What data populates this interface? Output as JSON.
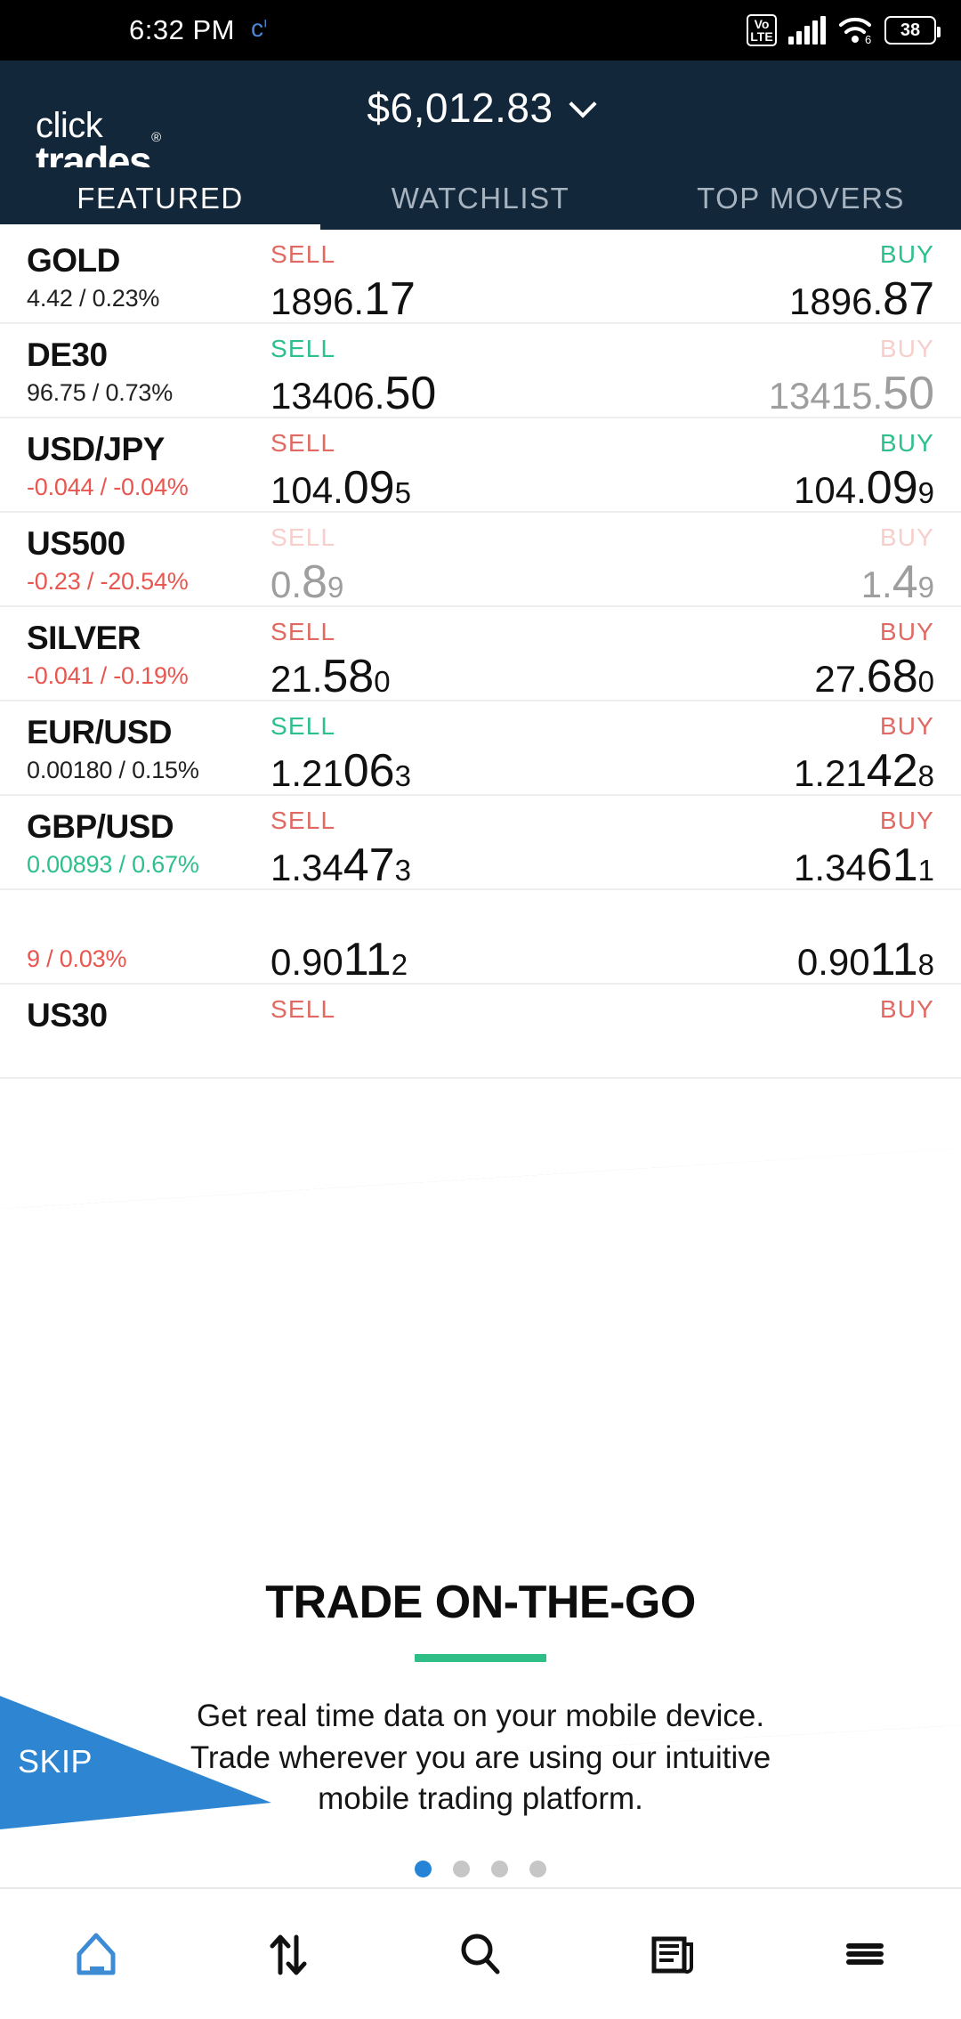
{
  "status_bar": {
    "time": "6:32 PM",
    "network_icon": "c-network-icon",
    "volte_top": "Vo",
    "volte_bottom": "LTE",
    "wifi_gen": "6",
    "battery_percent": "38"
  },
  "header": {
    "logo_line1": "click",
    "logo_line2": "trades",
    "logo_mark": "®",
    "balance": "$6,012.83",
    "balance_chevron": "chevron-down-icon"
  },
  "tabs": [
    {
      "label": "FEATURED",
      "active": true
    },
    {
      "label": "WATCHLIST",
      "active": false
    },
    {
      "label": "TOP MOVERS",
      "active": false
    }
  ],
  "quotes": [
    {
      "symbol": "GOLD",
      "change": "4.42 / 0.23%",
      "change_dir": "flat",
      "sell_label": "SELL",
      "sell_label_color": "red",
      "buy_label": "BUY",
      "buy_label_color": "green",
      "sell_price": {
        "a": "1896.",
        "b": "17",
        "c": "",
        "muted": false
      },
      "buy_price": {
        "a": "1896.",
        "b": "87",
        "c": "",
        "muted": false
      }
    },
    {
      "symbol": "DE30",
      "change": "96.75 / 0.73%",
      "change_dir": "flat",
      "sell_label": "SELL",
      "sell_label_color": "green",
      "buy_label": "BUY",
      "buy_label_color": "pale",
      "sell_price": {
        "a": "13406.",
        "b": "50",
        "c": "",
        "muted": false
      },
      "buy_price": {
        "a": "13415.",
        "b": "50",
        "c": "",
        "muted": true
      }
    },
    {
      "symbol": "USD/JPY",
      "change": "-0.044 / -0.04%",
      "change_dir": "down",
      "sell_label": "SELL",
      "sell_label_color": "red",
      "buy_label": "BUY",
      "buy_label_color": "green",
      "sell_price": {
        "a": "104.",
        "b": "09",
        "c": "5",
        "muted": false
      },
      "buy_price": {
        "a": "104.",
        "b": "09",
        "c": "9",
        "muted": false
      }
    },
    {
      "symbol": "US500",
      "change": "-0.23 / -20.54%",
      "change_dir": "down",
      "sell_label": "SELL",
      "sell_label_color": "pale",
      "buy_label": "BUY",
      "buy_label_color": "pale",
      "sell_price": {
        "a": "0.",
        "b": "8",
        "c": "9",
        "muted": true
      },
      "buy_price": {
        "a": "1.",
        "b": "4",
        "c": "9",
        "muted": true
      }
    },
    {
      "symbol": "SILVER",
      "change": "-0.041 / -0.19%",
      "change_dir": "down",
      "sell_label": "SELL",
      "sell_label_color": "red",
      "buy_label": "BUY",
      "buy_label_color": "red",
      "sell_price": {
        "a": "21.",
        "b": "58",
        "c": "0",
        "muted": false
      },
      "buy_price": {
        "a": "27.",
        "b": "68",
        "c": "0",
        "muted": false
      }
    },
    {
      "symbol": "EUR/USD",
      "change": "0.00180 / 0.15%",
      "change_dir": "flat",
      "sell_label": "SELL",
      "sell_label_color": "green",
      "buy_label": "BUY",
      "buy_label_color": "red",
      "sell_price": {
        "a": "1.21",
        "b": "06",
        "c": "3",
        "muted": false
      },
      "buy_price": {
        "a": "1.21",
        "b": "42",
        "c": "8",
        "muted": false
      }
    },
    {
      "symbol": "GBP/USD",
      "change": "0.00893 / 0.67%",
      "change_dir": "up",
      "sell_label": "SELL",
      "sell_label_color": "red",
      "buy_label": "BUY",
      "buy_label_color": "red",
      "sell_price": {
        "a": "1.34",
        "b": "47",
        "c": "3",
        "muted": false
      },
      "buy_price": {
        "a": "1.34",
        "b": "61",
        "c": "1",
        "muted": false
      }
    },
    {
      "symbol": "",
      "change": "9 / 0.03%",
      "change_dir": "down",
      "sell_label": "",
      "sell_label_color": "red",
      "buy_label": "",
      "buy_label_color": "red",
      "sell_price": {
        "a": "0.90",
        "b": "11",
        "c": "2",
        "muted": false
      },
      "buy_price": {
        "a": "0.90",
        "b": "11",
        "c": "8",
        "muted": false
      }
    },
    {
      "symbol": "US30",
      "change": "",
      "change_dir": "flat",
      "sell_label": "SELL",
      "sell_label_color": "red",
      "buy_label": "BUY",
      "buy_label_color": "red",
      "sell_price": {
        "a": "",
        "b": "",
        "c": "",
        "muted": false
      },
      "buy_price": {
        "a": "",
        "b": "",
        "c": "",
        "muted": false
      }
    }
  ],
  "onboarding": {
    "title": "TRADE ON-THE-GO",
    "body_line1": "Get real time data on your mobile device.",
    "body_line2": "Trade wherever you are using our intuitive",
    "body_line3": "mobile trading platform.",
    "skip_label": "SKIP",
    "total_dots": 4,
    "active_dot": 1,
    "accent_color": "#2fbf86",
    "skip_color": "#2e86d3",
    "active_dot_color": "#2684d6"
  },
  "bottom_nav": [
    {
      "icon": "home-icon",
      "active": true
    },
    {
      "icon": "trade-arrows-icon",
      "active": false
    },
    {
      "icon": "search-icon",
      "active": false
    },
    {
      "icon": "news-icon",
      "active": false
    },
    {
      "icon": "menu-icon",
      "active": false
    }
  ]
}
